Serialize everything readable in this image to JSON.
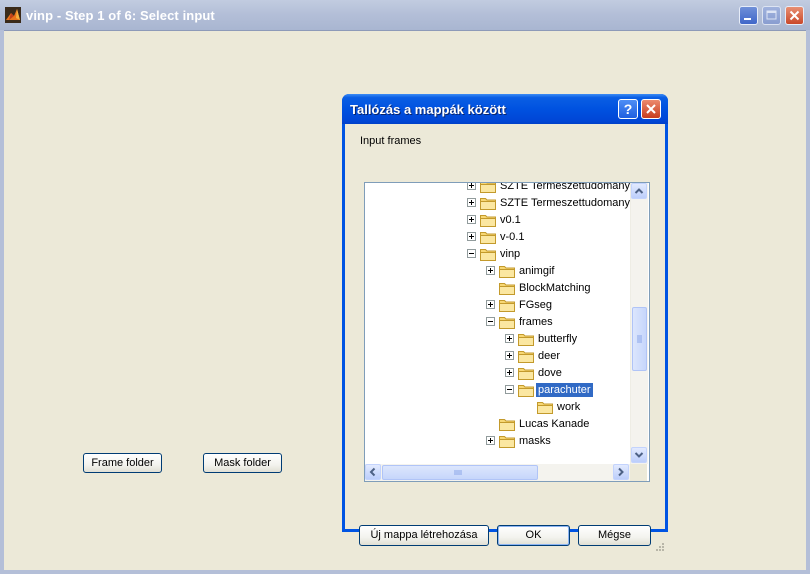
{
  "main_window": {
    "title": "vinp - Step 1 of 6: Select input",
    "app_icon": "matlab-icon",
    "buttons": {
      "frame_folder": "Frame folder",
      "mask_folder": "Mask folder"
    }
  },
  "dialog": {
    "title": "Tallózás a mappák között",
    "help_label": "?",
    "prompt": "Input frames",
    "tree": [
      {
        "label": "SZTE Termeszettudomanyi",
        "expander": "plus",
        "level": 0
      },
      {
        "label": "SZTE Termeszettudomanyi",
        "expander": "plus",
        "level": 0
      },
      {
        "label": "v0.1",
        "expander": "plus",
        "level": 0
      },
      {
        "label": "v-0.1",
        "expander": "plus",
        "level": 0
      },
      {
        "label": "vinp",
        "expander": "minus",
        "level": 0
      },
      {
        "label": "animgif",
        "expander": "plus",
        "level": 1
      },
      {
        "label": "BlockMatching",
        "expander": "none",
        "level": 1
      },
      {
        "label": "FGseg",
        "expander": "plus",
        "level": 1
      },
      {
        "label": "frames",
        "expander": "minus",
        "level": 1
      },
      {
        "label": "butterfly",
        "expander": "plus",
        "level": 2
      },
      {
        "label": "deer",
        "expander": "plus",
        "level": 2
      },
      {
        "label": "dove",
        "expander": "plus",
        "level": 2
      },
      {
        "label": "parachuter",
        "expander": "minus",
        "level": 2,
        "selected": true
      },
      {
        "label": "work",
        "expander": "none",
        "level": 3
      },
      {
        "label": "Lucas Kanade",
        "expander": "none",
        "level": 1
      },
      {
        "label": "masks",
        "expander": "plus",
        "level": 1
      }
    ],
    "buttons": {
      "new_folder": "Új mappa létrehozása",
      "ok": "OK",
      "cancel": "Mégse"
    }
  }
}
